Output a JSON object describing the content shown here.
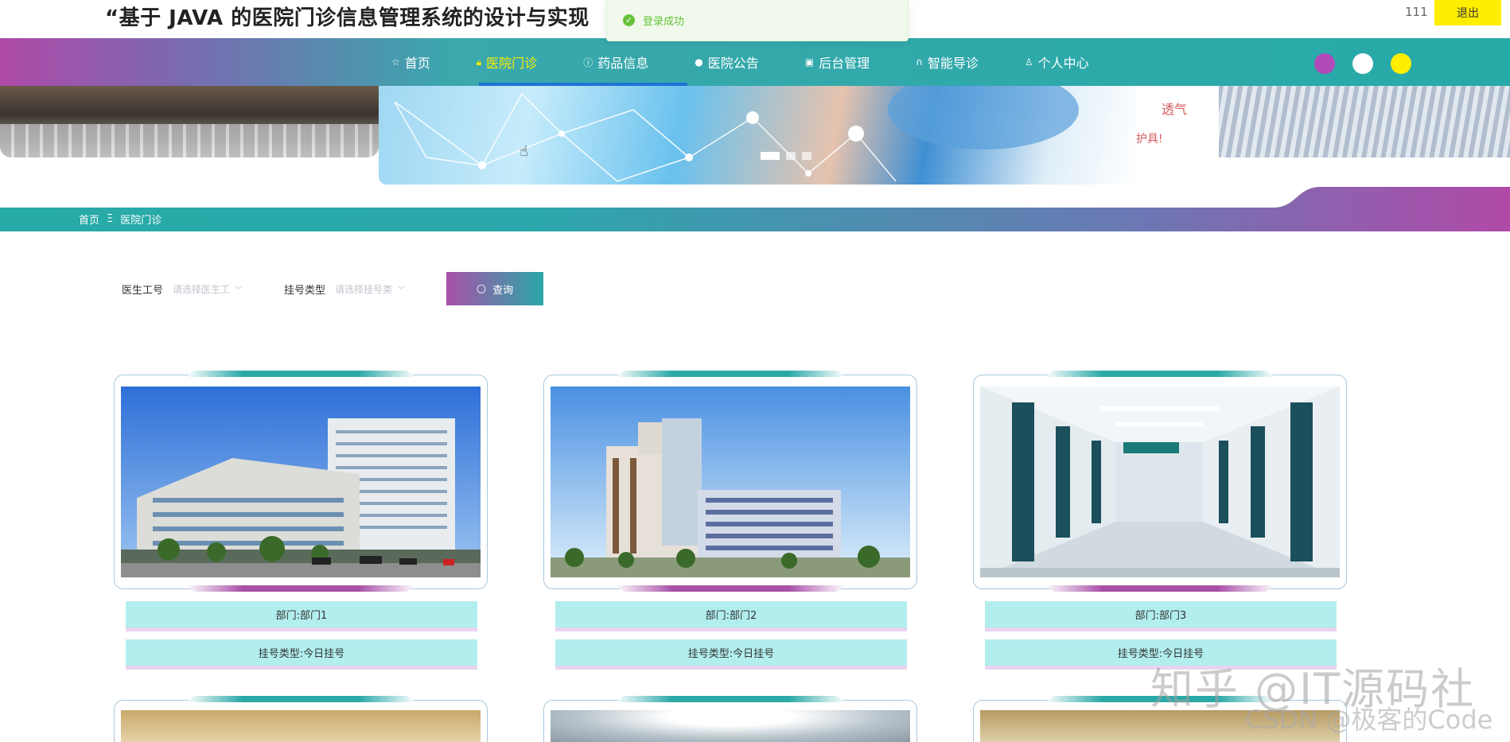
{
  "header": {
    "title": "“基于 JAVA 的医院门诊信息管理系统的设计与实现",
    "username": "111",
    "logout_label": "退出"
  },
  "toast": {
    "icon": "check-circle-icon",
    "message": "登录成功"
  },
  "nav": {
    "items": [
      {
        "label": "首页",
        "icon": "star-icon",
        "active": false
      },
      {
        "label": "医院门诊",
        "icon": "lock-icon",
        "active": true
      },
      {
        "label": "药品信息",
        "icon": "info-icon",
        "active": false
      },
      {
        "label": "医院公告",
        "icon": "circle-icon",
        "active": false
      },
      {
        "label": "后台管理",
        "icon": "briefcase-icon",
        "active": false
      },
      {
        "label": "智能导诊",
        "icon": "headset-icon",
        "active": false
      },
      {
        "label": "个人中心",
        "icon": "user-icon",
        "active": false
      }
    ],
    "theme_colors": [
      "#b04ab8",
      "#ffffff",
      "#ffee00"
    ]
  },
  "banner": {
    "text_line1": "透气",
    "text_line2": "护具!",
    "slides": 3,
    "active_slide": 1
  },
  "breadcrumb": {
    "home": "首页",
    "separator": "Ξ",
    "current": "医院门诊"
  },
  "search": {
    "doctor_label": "医生工号",
    "doctor_placeholder": "请选择医生工",
    "type_label": "挂号类型",
    "type_placeholder": "请选择挂号类",
    "button_label": "查询"
  },
  "cards": [
    {
      "department": "部门:部门1",
      "reg_type": "挂号类型:今日挂号"
    },
    {
      "department": "部门:部门2",
      "reg_type": "挂号类型:今日挂号"
    },
    {
      "department": "部门:部门3",
      "reg_type": "挂号类型:今日挂号"
    }
  ],
  "watermark": {
    "line1": "知乎 @IT源码社",
    "line2": "CSDN @极客的Code"
  }
}
